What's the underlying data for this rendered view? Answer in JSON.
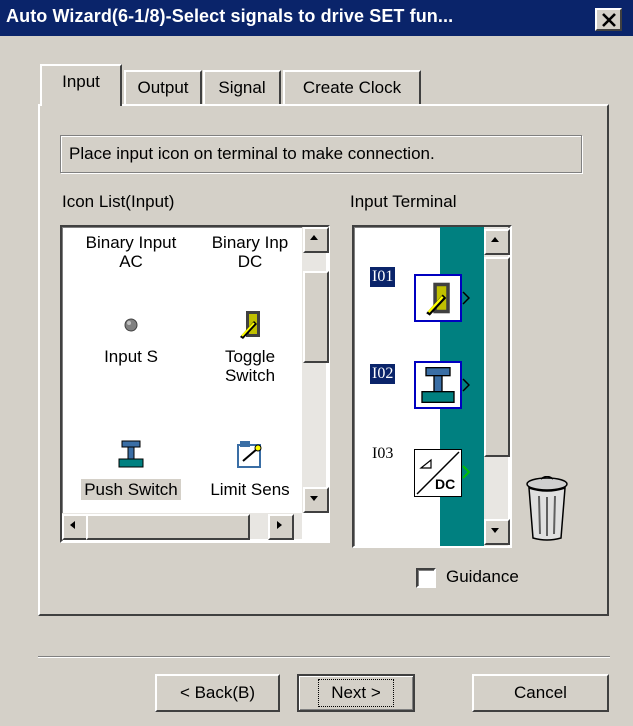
{
  "window": {
    "title": "Auto Wizard(6-1/8)-Select signals to drive SET fun...",
    "close_label": "×"
  },
  "tabs": [
    {
      "label": "Input",
      "selected": true
    },
    {
      "label": "Output",
      "selected": false
    },
    {
      "label": "Signal",
      "selected": false
    },
    {
      "label": "Create Clock",
      "selected": false
    }
  ],
  "instruction": "Place input icon on terminal to make connection.",
  "icon_list": {
    "label": "Icon List(Input)",
    "items": [
      {
        "label1": "Binary Input",
        "label2": "AC",
        "icon": "none"
      },
      {
        "label1": "Binary Inp",
        "label2": "DC",
        "icon": "none"
      },
      {
        "label1": "Input S",
        "label2": "",
        "icon": "dot-icon"
      },
      {
        "label1": "Toggle",
        "label2": "Switch",
        "icon": "toggle-switch-icon"
      },
      {
        "label1": "Push Switch",
        "label2": "",
        "icon": "push-switch-icon"
      },
      {
        "label1": "Limit Sens",
        "label2": "",
        "icon": "limit-sensor-icon"
      }
    ]
  },
  "terminal": {
    "label": "Input Terminal",
    "items": [
      {
        "id": "I01",
        "icon": "toggle-switch-icon",
        "highlighted": true
      },
      {
        "id": "I02",
        "icon": "push-switch-icon",
        "highlighted": true
      },
      {
        "id": "I03",
        "icon": "dc-converter-icon",
        "highlighted": false
      }
    ],
    "dc_text": "DC"
  },
  "guidance": {
    "label": "Guidance",
    "checked": false
  },
  "buttons": {
    "back": "< Back(B)",
    "next": "Next >",
    "cancel": "Cancel"
  },
  "colors": {
    "title_bar": "#0a246a",
    "terminal_bar": "#008080",
    "face": "#d4d0c8"
  }
}
